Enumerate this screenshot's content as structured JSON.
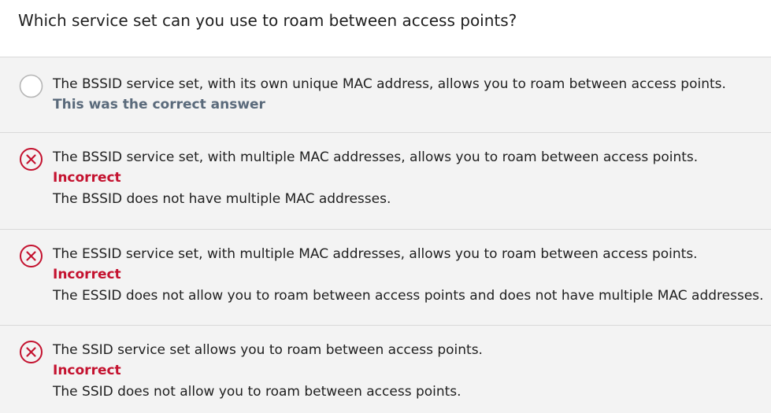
{
  "question": {
    "text": "Which service set can you use to roam between access points?"
  },
  "options": [
    {
      "text": "The BSSID service set, with its own unique MAC address, allows you to roam between access points.",
      "status": "This was the correct answer",
      "feedback": "",
      "icon": "radio-empty-icon"
    },
    {
      "text": "The BSSID service set, with multiple MAC addresses, allows you to roam between access points.",
      "status": "Incorrect",
      "feedback": "The BSSID does not have multiple MAC addresses.",
      "icon": "incorrect-x-icon"
    },
    {
      "text": "The ESSID service set, with multiple MAC addresses, allows you to roam between access points.",
      "status": "Incorrect",
      "feedback": "The ESSID does not allow you to roam between access points and does not have multiple MAC addresses.",
      "icon": "incorrect-x-icon"
    },
    {
      "text": "The SSID service set allows you to roam between access points.",
      "status": "Incorrect",
      "feedback": "The SSID does not allow you to roam between access points.",
      "icon": "incorrect-x-icon"
    }
  ],
  "colors": {
    "incorrect": "#c4122f",
    "correct_note": "#5a6a7b",
    "background": "#f3f3f3",
    "divider": "#d9d9d9"
  }
}
